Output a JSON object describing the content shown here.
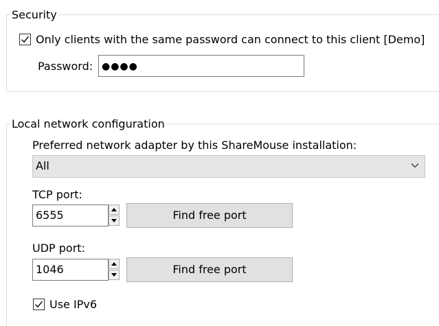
{
  "security": {
    "legend": "Security",
    "only_same_password": {
      "label": "Only clients with the same password can connect to this client [Demo]",
      "checked": true
    },
    "password_label": "Password:",
    "password_dots": "●●●●"
  },
  "network": {
    "legend": "Local network configuration",
    "adapter_label": "Preferred network adapter by this ShareMouse installation:",
    "adapter_value": "All",
    "tcp_label": "TCP port:",
    "tcp_value": "6555",
    "tcp_find_button": "Find free port",
    "udp_label": "UDP port:",
    "udp_value": "1046",
    "udp_find_button": "Find free port",
    "ipv6": {
      "label": "Use IPv6",
      "checked": true
    }
  },
  "icons": {
    "check": "checkmark-icon",
    "chevron": "chevron-down-icon",
    "spin_up": "triangle-up-icon",
    "spin_down": "triangle-down-icon"
  },
  "colors": {
    "group_border": "#dcdcdc",
    "button_bg": "#e1e1e1",
    "select_bg": "#e5e5e5",
    "input_border": "#7a7a7a"
  }
}
